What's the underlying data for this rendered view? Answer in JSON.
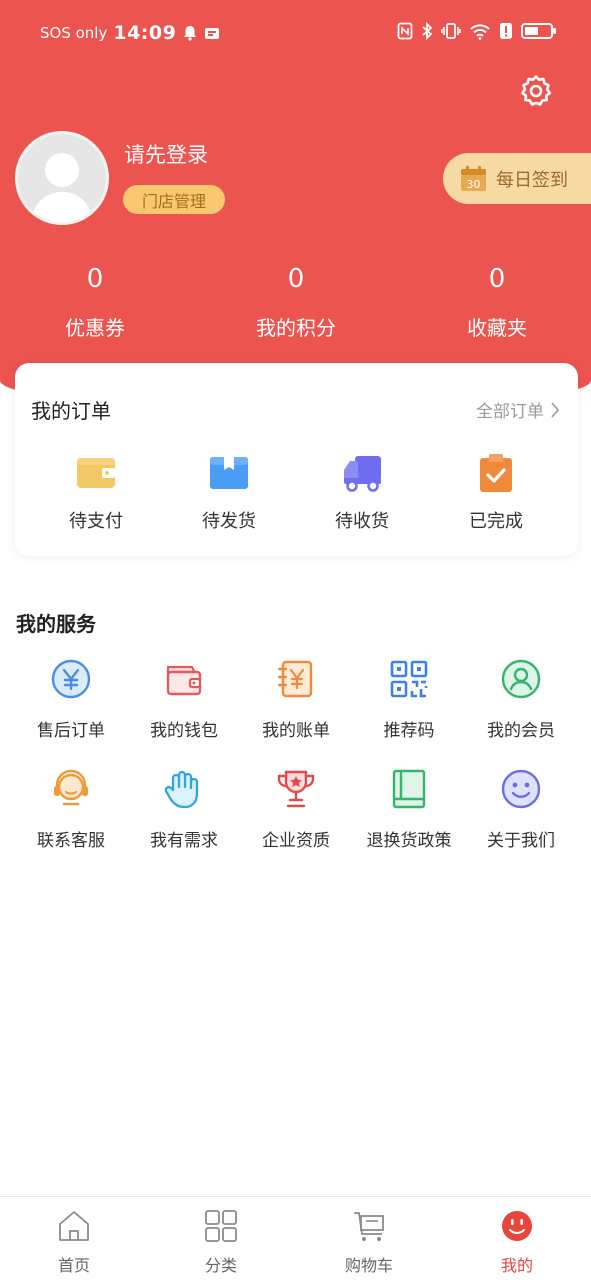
{
  "status_bar": {
    "carrier": "SOS only",
    "time": "14:09",
    "battery_level": 0.55
  },
  "profile": {
    "login_prompt": "请先登录",
    "store_management": "门店管理",
    "daily_checkin": "每日签到",
    "checkin_calendar_day": "30"
  },
  "stats": [
    {
      "value": "0",
      "label": "优惠券"
    },
    {
      "value": "0",
      "label": "我的积分"
    },
    {
      "value": "0",
      "label": "收藏夹"
    }
  ],
  "orders": {
    "title": "我的订单",
    "all_orders": "全部订单",
    "items": [
      {
        "label": "待支付",
        "icon": "wallet-icon"
      },
      {
        "label": "待发货",
        "icon": "package-icon"
      },
      {
        "label": "待收货",
        "icon": "truck-icon"
      },
      {
        "label": "已完成",
        "icon": "clipboard-check-icon"
      }
    ]
  },
  "services": {
    "title": "我的服务",
    "items": [
      {
        "label": "售后订单",
        "icon": "yen-circle-icon"
      },
      {
        "label": "我的钱包",
        "icon": "wallet-icon"
      },
      {
        "label": "我的账单",
        "icon": "bill-icon"
      },
      {
        "label": "推荐码",
        "icon": "qr-code-icon"
      },
      {
        "label": "我的会员",
        "icon": "member-icon"
      },
      {
        "label": "联系客服",
        "icon": "headset-icon"
      },
      {
        "label": "我有需求",
        "icon": "hand-icon"
      },
      {
        "label": "企业资质",
        "icon": "trophy-icon"
      },
      {
        "label": "退换货政策",
        "icon": "book-icon"
      },
      {
        "label": "关于我们",
        "icon": "smile-icon"
      }
    ]
  },
  "tabbar": {
    "items": [
      {
        "label": "首页",
        "icon": "home-icon"
      },
      {
        "label": "分类",
        "icon": "category-grid-icon"
      },
      {
        "label": "购物车",
        "icon": "cart-icon"
      },
      {
        "label": "我的",
        "icon": "profile-face-icon"
      }
    ],
    "active_index": 3
  },
  "colors": {
    "brand_red": "#ec5450",
    "gold": "#f7c870",
    "active_tab": "#e8453c"
  }
}
